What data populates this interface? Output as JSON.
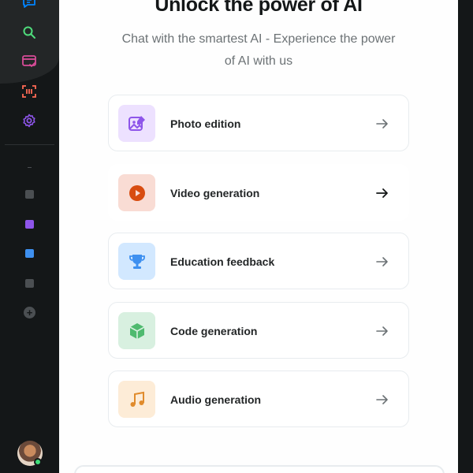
{
  "sidebar": {
    "nav_icons": [
      "chat-icon",
      "search-icon",
      "card-check-icon",
      "scan-icon",
      "settings-icon"
    ],
    "colors": {
      "chat": "#0084ff",
      "search": "#4fdd7c",
      "card": "#d84c98",
      "scan": "#ff6a55",
      "settings": "#8e55ea",
      "folder_gray": "#4b4f52",
      "folder_purple": "#8e55ea",
      "folder_blue": "#3e90f0"
    }
  },
  "main": {
    "title": "Unlock the power of AI",
    "subtitle": "Chat with the smartest AI - Experience the power of AI with us",
    "cards": [
      {
        "label": "Photo edition",
        "icon": "photo-edit-icon",
        "bg": "#ede1ff",
        "color": "#8e55ea"
      },
      {
        "label": "Video generation",
        "icon": "play-icon",
        "bg": "#f9dcd4",
        "color": "#d84c10"
      },
      {
        "label": "Education feedback",
        "icon": "trophy-icon",
        "bg": "#d2e8ff",
        "color": "#3e90f0"
      },
      {
        "label": "Code generation",
        "icon": "code-cube-icon",
        "bg": "#d8f0e0",
        "color": "#4fba6f"
      },
      {
        "label": "Audio generation",
        "icon": "music-note-icon",
        "bg": "#fdecd7",
        "color": "#e08b2c"
      }
    ]
  }
}
